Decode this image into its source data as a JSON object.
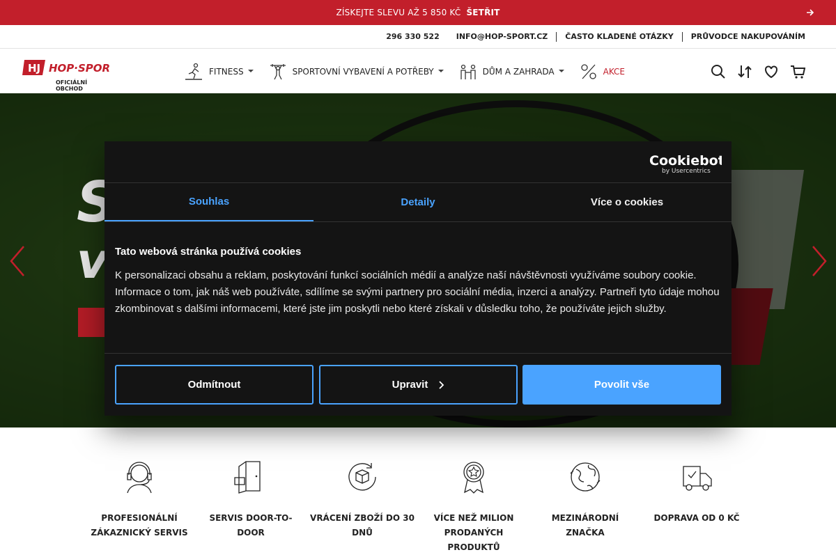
{
  "promo": {
    "text": "ZÍSKEJTE SLEVU AŽ 5 850 KČ",
    "code": "ŠETŘIT",
    "icon": "arrow-right-icon"
  },
  "top_links": [
    "296 330 522",
    "INFO@HOP-SPORT.CZ",
    "ČASTO KLADENÉ OTÁZKY",
    "PRŮVODCE NAKUPOVÁNÍM"
  ],
  "logo": {
    "sub": "OFICIÁLNÍ OBCHOD"
  },
  "nav": [
    {
      "label": "FITNESS",
      "icon": "treadmill-icon"
    },
    {
      "label": "SPORTOVNÍ VYBAVENÍ A POTŘEBY",
      "icon": "weightlifter-icon"
    },
    {
      "label": "DŮM A ZAHRADA",
      "icon": "family-icon"
    },
    {
      "label": "AKCE",
      "icon": "percent-icon"
    }
  ],
  "header_icons": [
    "search-icon",
    "compare-icon",
    "heart-icon",
    "cart-icon"
  ],
  "hero": {
    "letter_s": "S",
    "letter_v": "v"
  },
  "cookie": {
    "tabs": [
      "Souhlas",
      "Detaily",
      "Více o cookies"
    ],
    "active_tab": "Souhlas",
    "title": "Tato webová stránka používá cookies",
    "body": "K personalizaci obsahu a reklam, poskytování funkcí sociálních médií a analýze naší návštěvnosti využíváme soubory cookie. Informace o tom, jak náš web používáte, sdílíme se svými partnery pro sociální média, inzerci a analýzy. Partneři tyto údaje mohou zkombinovat s dalšími informacemi, které jste jim poskytli nebo které získali v důsledku toho, že používáte jejich služby.",
    "reject": "Odmítnout",
    "customize": "Upravit",
    "allow_all": "Povolit vše",
    "accent": "#4aa3ff"
  },
  "features": [
    {
      "label": "PROFESIONÁLNÍ ZÁKAZNICKÝ SERVIS",
      "icon": "headset-icon"
    },
    {
      "label": "SERVIS DOOR-TO-DOOR",
      "icon": "door-icon"
    },
    {
      "label": "VRÁCENÍ ZBOŽÍ DO 30 DNŮ",
      "icon": "return-box-icon"
    },
    {
      "label": "VÍCE NEŽ MILION PRODANÝCH PRODUKTŮ",
      "icon": "award-icon"
    },
    {
      "label": "MEZINÁRODNÍ ZNAČKA",
      "icon": "globe-icon"
    },
    {
      "label": "DOPRAVA OD 0 KČ",
      "icon": "truck-icon"
    }
  ],
  "colors": {
    "brand_red": "#c21f2b"
  }
}
